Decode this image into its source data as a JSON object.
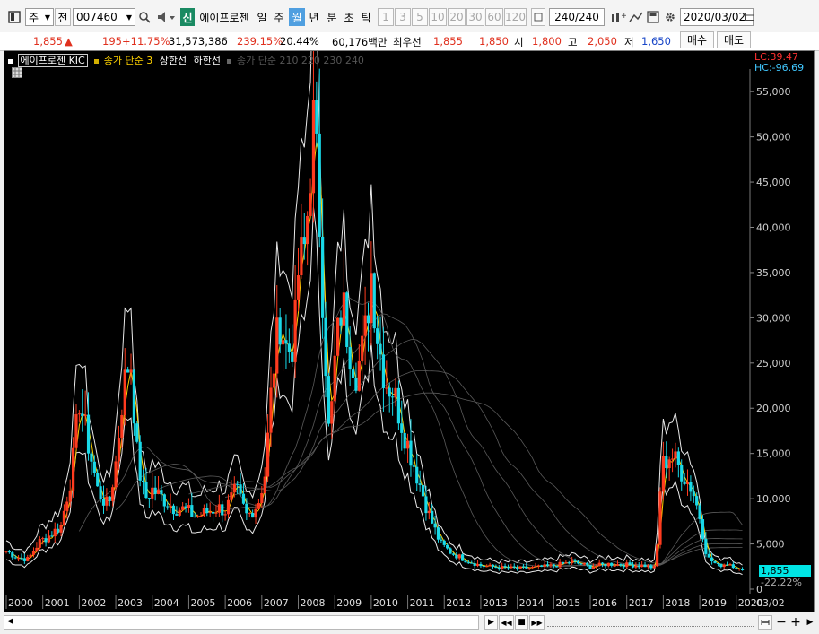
{
  "toolbar": {
    "market": "주",
    "prev_label": "전",
    "code": "007460",
    "badge": "신",
    "stock_name": "에이프로젠",
    "periods": [
      "일",
      "주",
      "월",
      "년",
      "분",
      "초",
      "틱"
    ],
    "period_active": "월",
    "numbers": [
      "1",
      "3",
      "5",
      "10",
      "20",
      "30",
      "60",
      "120"
    ],
    "count": "240",
    "count_total": "/240",
    "date": "2020/03/02"
  },
  "quote": {
    "price": "1,855",
    "arrow": "▲",
    "change": "195",
    "change_pct": "+11.75%",
    "volume": "31,573,386",
    "vol_ratio": "239.15%",
    "turnover": "20.44%",
    "amount": "60,176백만",
    "ma_label": "최우선",
    "ask": "1,855",
    "bid": "1,850",
    "open_label": "시",
    "open": "1,800",
    "high_label": "고",
    "high": "2,050",
    "low_label": "저",
    "low": "1,650",
    "buy": "매수",
    "sell": "매도"
  },
  "chart_legend": {
    "title": "에이프로젠 KIC",
    "ma_text": "종가 단순 3",
    "upper": "상한선",
    "lower": "하한선",
    "ma2_text": "종가 단순 210 220 230 240"
  },
  "channel": {
    "lc": "LC:39.47",
    "hc": "HC:-96.69"
  },
  "chart_data": {
    "type": "candlestick",
    "y_ticks": [
      "55,000",
      "50,000",
      "45,000",
      "40,000",
      "35,000",
      "30,000",
      "25,000",
      "20,000",
      "15,000",
      "10,000",
      "5,000",
      "0"
    ],
    "ylim": [
      0,
      57000
    ],
    "x_ticks": [
      "2000",
      "2001",
      "2002",
      "2003",
      "2004",
      "2005",
      "2006",
      "2007",
      "2008",
      "2009",
      "2010",
      "2011",
      "2012",
      "2013",
      "2014",
      "2015",
      "2016",
      "2017",
      "2018",
      "2019",
      "2020"
    ],
    "x_end_label": "03/02",
    "current_price": "1,855",
    "current_pct": "-22.22%",
    "close_series": [
      [
        2000.0,
        4200
      ],
      [
        2000.3,
        3500
      ],
      [
        2000.6,
        3300
      ],
      [
        2000.9,
        5200
      ],
      [
        2001.2,
        6000
      ],
      [
        2001.5,
        7000
      ],
      [
        2001.8,
        13000
      ],
      [
        2002.0,
        21000
      ],
      [
        2002.2,
        17000
      ],
      [
        2002.5,
        11000
      ],
      [
        2002.8,
        9000
      ],
      [
        2003.0,
        14000
      ],
      [
        2003.2,
        22000
      ],
      [
        2003.4,
        26000
      ],
      [
        2003.6,
        14000
      ],
      [
        2003.8,
        10000
      ],
      [
        2004.0,
        11000
      ],
      [
        2004.3,
        10000
      ],
      [
        2004.6,
        9000
      ],
      [
        2004.9,
        8800
      ],
      [
        2005.2,
        8000
      ],
      [
        2005.5,
        8500
      ],
      [
        2005.8,
        9000
      ],
      [
        2006.0,
        8700
      ],
      [
        2006.3,
        11000
      ],
      [
        2006.6,
        8000
      ],
      [
        2006.9,
        9500
      ],
      [
        2007.1,
        13000
      ],
      [
        2007.3,
        24000
      ],
      [
        2007.5,
        30000
      ],
      [
        2007.7,
        26000
      ],
      [
        2007.9,
        28000
      ],
      [
        2008.0,
        35000
      ],
      [
        2008.2,
        38000
      ],
      [
        2008.4,
        52000
      ],
      [
        2008.55,
        44000
      ],
      [
        2008.7,
        30000
      ],
      [
        2008.85,
        16000
      ],
      [
        2009.0,
        25000
      ],
      [
        2009.2,
        32000
      ],
      [
        2009.4,
        27000
      ],
      [
        2009.6,
        24000
      ],
      [
        2009.8,
        27000
      ],
      [
        2010.0,
        35000
      ],
      [
        2010.2,
        27000
      ],
      [
        2010.4,
        23000
      ],
      [
        2010.6,
        22000
      ],
      [
        2010.8,
        19000
      ],
      [
        2011.0,
        16000
      ],
      [
        2011.3,
        12000
      ],
      [
        2011.6,
        8000
      ],
      [
        2011.9,
        5000
      ],
      [
        2012.2,
        4000
      ],
      [
        2012.6,
        3200
      ],
      [
        2013.0,
        2600
      ],
      [
        2013.5,
        2400
      ],
      [
        2014.0,
        2300
      ],
      [
        2014.5,
        2400
      ],
      [
        2015.0,
        2600
      ],
      [
        2015.5,
        3000
      ],
      [
        2016.0,
        2500
      ],
      [
        2016.5,
        2800
      ],
      [
        2017.0,
        2700
      ],
      [
        2017.5,
        2600
      ],
      [
        2017.8,
        2300
      ],
      [
        2017.95,
        13500
      ],
      [
        2018.2,
        15000
      ],
      [
        2018.5,
        13000
      ],
      [
        2018.8,
        11000
      ],
      [
        2019.0,
        8000
      ],
      [
        2019.2,
        3500
      ],
      [
        2019.5,
        2600
      ],
      [
        2019.8,
        2900
      ],
      [
        2020.0,
        2400
      ],
      [
        2020.2,
        1855
      ]
    ]
  },
  "bottom": {
    "nav": [
      "▶",
      "◀◀",
      "■",
      "▶▶"
    ],
    "zoom_minus": "−",
    "zoom_plus": "+"
  }
}
